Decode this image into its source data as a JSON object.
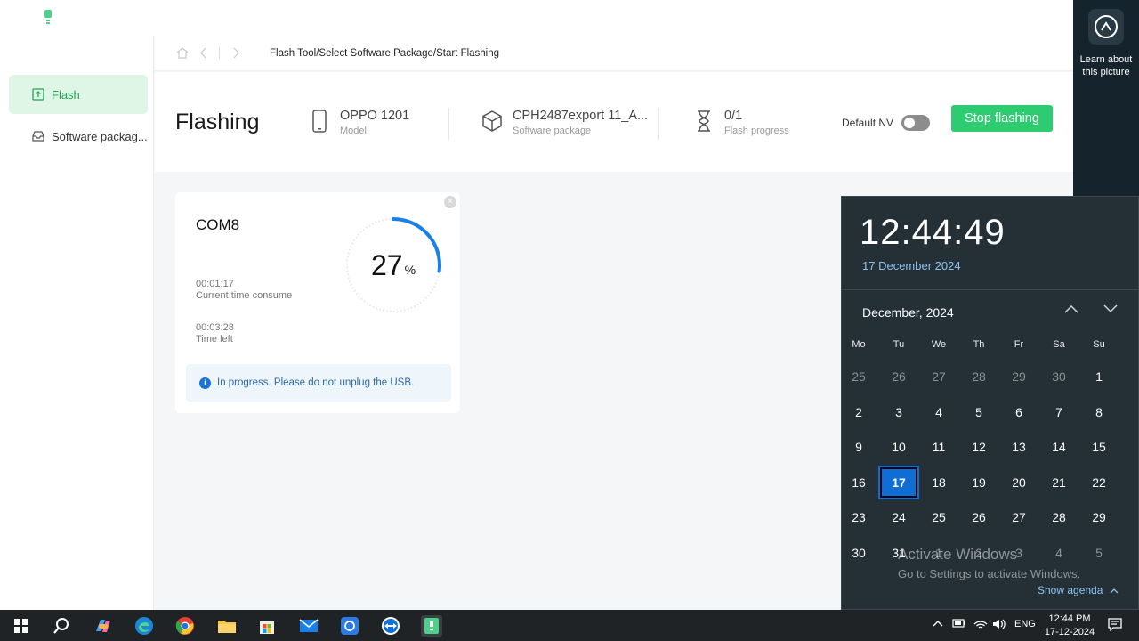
{
  "breadcrumb": "Flash Tool/Select Software Package/Start Flashing",
  "sidebar": {
    "items": [
      {
        "label": "Flash"
      },
      {
        "label": "Software packag..."
      }
    ]
  },
  "header": {
    "title": "Flashing",
    "model": {
      "value": "OPPO 1201",
      "label": "Model"
    },
    "package": {
      "value": "CPH2487export 11_A...",
      "label": "Software package"
    },
    "progress": {
      "value": "0/1",
      "label": "Flash progress"
    },
    "default_nv_label": "Default NV",
    "default_nv_on": false,
    "stop_label": "Stop flashing",
    "accent": "#2ecc71"
  },
  "card": {
    "port": "COM8",
    "elapsed": "00:01:17",
    "elapsed_label": "Current time consume",
    "remaining": "00:03:28",
    "remaining_label": "Time left",
    "percent": "27",
    "percent_unit": "%",
    "percent_fraction": 0.27,
    "notice": "In progress. Please do not unplug the USB."
  },
  "desktop": {
    "learn_text": "Learn about this picture"
  },
  "calendar": {
    "time": "12:44:49",
    "date": "17 December 2024",
    "month": "December, 2024",
    "weekdays": [
      "Mo",
      "Tu",
      "We",
      "Th",
      "Fr",
      "Sa",
      "Su"
    ],
    "days": [
      [
        "25",
        "26",
        "27",
        "28",
        "29",
        "30",
        "1"
      ],
      [
        "2",
        "3",
        "4",
        "5",
        "6",
        "7",
        "8"
      ],
      [
        "9",
        "10",
        "11",
        "12",
        "13",
        "14",
        "15"
      ],
      [
        "16",
        "17",
        "18",
        "19",
        "20",
        "21",
        "22"
      ],
      [
        "23",
        "24",
        "25",
        "26",
        "27",
        "28",
        "29"
      ],
      [
        "30",
        "31",
        "1",
        "2",
        "3",
        "4",
        "5"
      ]
    ],
    "today": "17",
    "watermark_title": "Activate Windows",
    "watermark_sub": "Go to Settings to activate Windows.",
    "show_agenda": "Show agenda"
  },
  "taskbar": {
    "lang": "ENG",
    "time": "12:44 PM",
    "date": "17-12-2024"
  }
}
